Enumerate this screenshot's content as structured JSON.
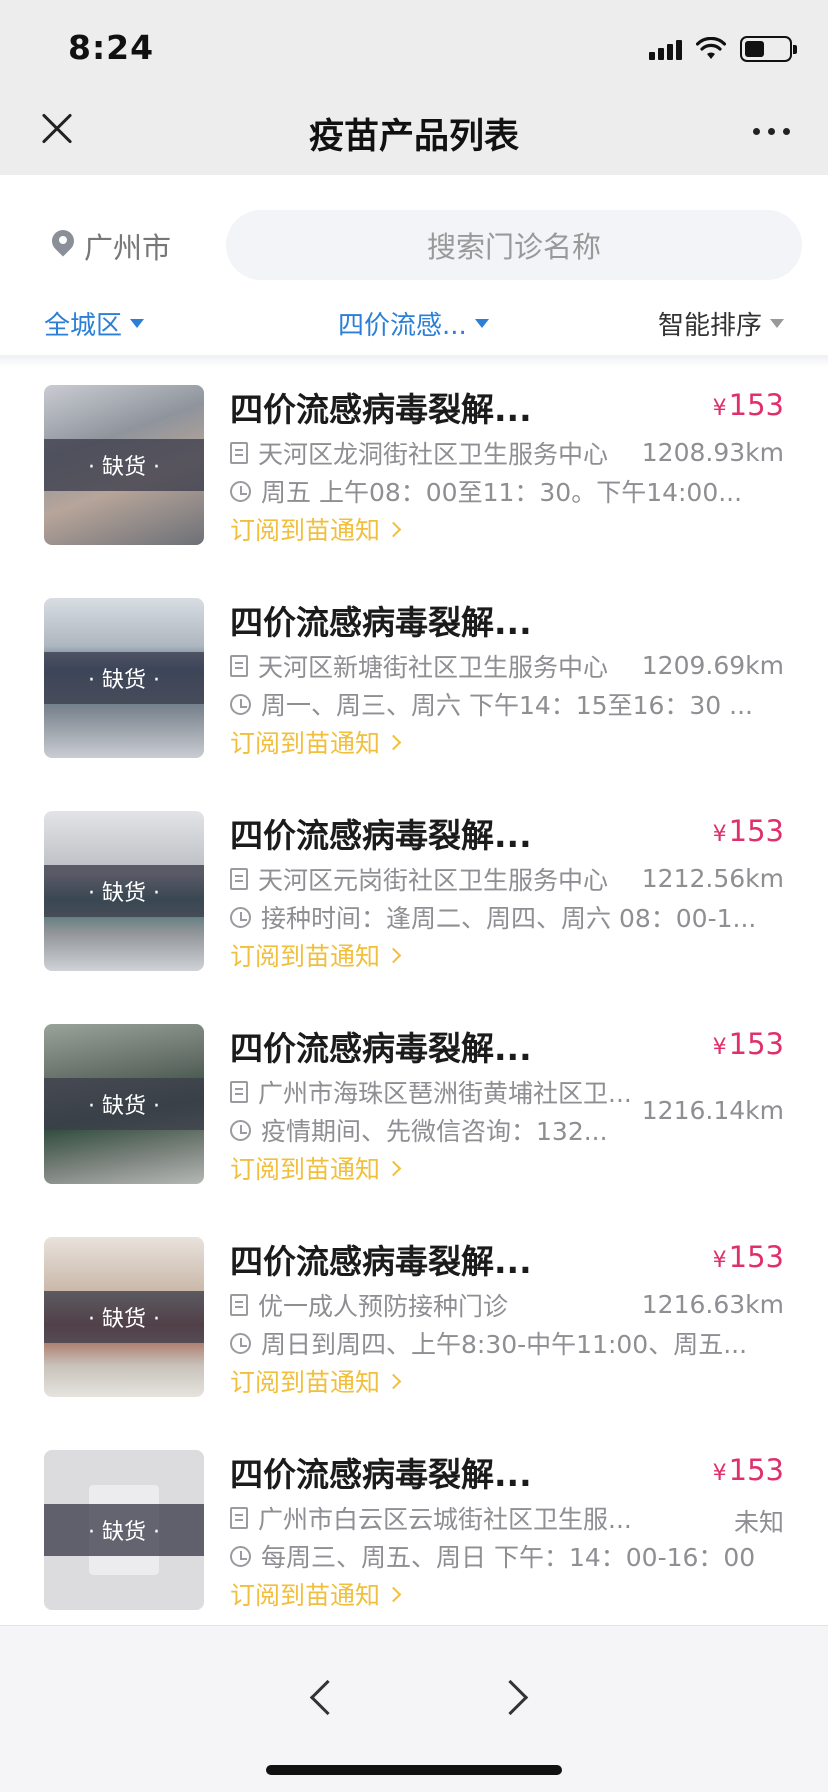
{
  "status_bar": {
    "time": "8:24"
  },
  "header": {
    "title": "疫苗产品列表"
  },
  "search": {
    "city": "广州市",
    "placeholder": "搜索门诊名称"
  },
  "filters": {
    "region": "全城区",
    "product": "四价流感...",
    "sort": "智能排序"
  },
  "items": [
    {
      "name": "四价流感病毒裂解...",
      "price": "153",
      "stock": "· 缺货 ·",
      "clinic": "天河区龙洞街社区卫生服务中心",
      "distance": "1208.93km",
      "hours": "周五 上午08：00至11：30。下午14:00...",
      "subscribe": "订阅到苗通知",
      "show_price": true
    },
    {
      "name": "四价流感病毒裂解...",
      "price": "",
      "stock": "· 缺货 ·",
      "clinic": "天河区新塘街社区卫生服务中心",
      "distance": "1209.69km",
      "hours": "周一、周三、周六 下午14：15至16：30 ...",
      "subscribe": "订阅到苗通知",
      "show_price": false
    },
    {
      "name": "四价流感病毒裂解...",
      "price": "153",
      "stock": "· 缺货 ·",
      "clinic": "天河区元岗街社区卫生服务中心",
      "distance": "1212.56km",
      "hours": "接种时间：逢周二、周四、周六 08：00-1...",
      "subscribe": "订阅到苗通知",
      "show_price": true
    },
    {
      "name": "四价流感病毒裂解...",
      "price": "153",
      "stock": "· 缺货 ·",
      "clinic": "广州市海珠区琶洲街黄埔社区卫...",
      "distance": "1216.14km",
      "hours": "疫情期间、先微信咨询：132...",
      "subscribe": "订阅到苗通知",
      "show_price": true
    },
    {
      "name": "四价流感病毒裂解...",
      "price": "153",
      "stock": "· 缺货 ·",
      "clinic": "优一成人预防接种门诊",
      "distance": "1216.63km",
      "hours": "周日到周四、上午8:30-中午11:00、周五...",
      "subscribe": "订阅到苗通知",
      "show_price": true
    },
    {
      "name": "四价流感病毒裂解...",
      "price": "153",
      "stock": "· 缺货 ·",
      "clinic": "广州市白云区云城街社区卫生服...",
      "distance": "未知",
      "hours": "每周三、周五、周日 下午：14：00-16：00",
      "subscribe": "订阅到苗通知",
      "show_price": true
    }
  ],
  "colors": {
    "accent_blue": "#2b7fd6",
    "price_red": "#e0306a",
    "subscribe_yellow": "#f1bf3b"
  }
}
